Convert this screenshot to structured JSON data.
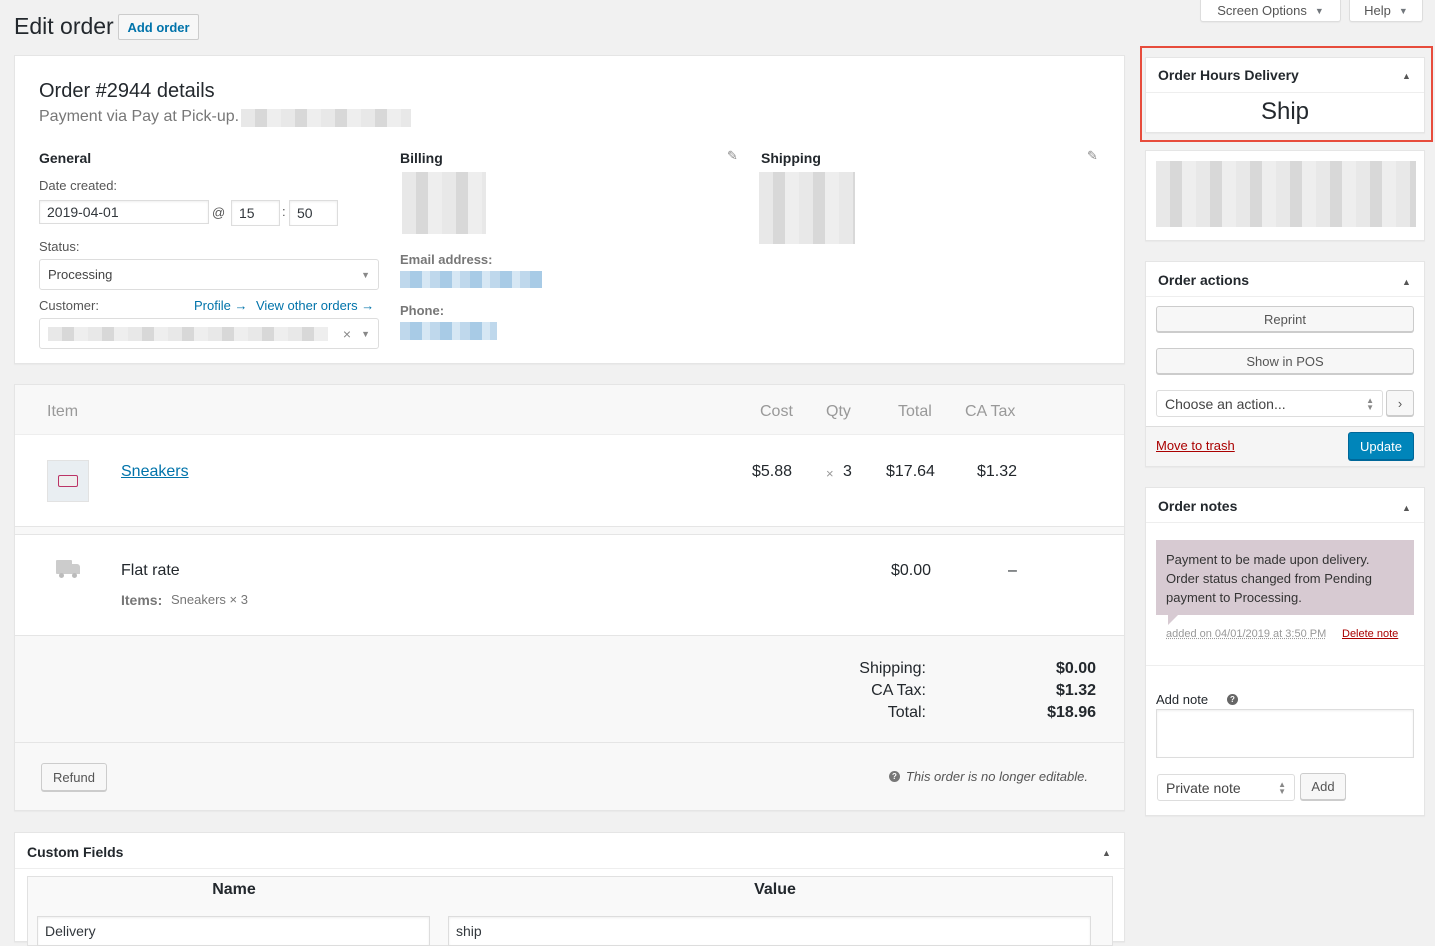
{
  "header": {
    "screen_options": "Screen Options",
    "help": "Help",
    "title": "Edit order",
    "add_order": "Add order"
  },
  "order": {
    "heading": "Order #2944 details",
    "payment": "Payment via Pay at Pick-up.",
    "general": {
      "title": "General",
      "date_label": "Date created:",
      "date": "2019-04-01",
      "at": "@",
      "hour": "15",
      "colon": ":",
      "minute": "50",
      "status_label": "Status:",
      "status": "Processing",
      "customer_label": "Customer:",
      "profile_link": "Profile →",
      "other_orders_link": "View other orders →",
      "clear_x": "×"
    },
    "billing": {
      "title": "Billing",
      "email_label": "Email address:",
      "phone_label": "Phone:"
    },
    "shipping": {
      "title": "Shipping"
    }
  },
  "items": {
    "columns": {
      "item": "Item",
      "cost": "Cost",
      "qty": "Qty",
      "total": "Total",
      "tax": "CA Tax"
    },
    "product": {
      "name": "Sneakers",
      "cost": "$5.88",
      "times": "×",
      "qty": "3",
      "total": "$17.64",
      "tax": "$1.32"
    },
    "shipping_line": {
      "name": "Flat rate",
      "items_label": "Items:",
      "items_value": "Sneakers × 3",
      "total": "$0.00",
      "tax": "–"
    },
    "totals": [
      {
        "label": "Shipping:",
        "value": "$0.00"
      },
      {
        "label": "CA Tax:",
        "value": "$1.32"
      },
      {
        "label": "Total:",
        "value": "$18.96"
      }
    ],
    "refund": "Refund",
    "not_editable": "This order is no longer editable."
  },
  "custom_fields": {
    "title": "Custom Fields",
    "col_name": "Name",
    "col_value": "Value",
    "row_name": "Delivery",
    "row_value": "ship"
  },
  "sidebar": {
    "hours_delivery": {
      "title": "Order Hours Delivery",
      "value": "Ship"
    },
    "actions": {
      "title": "Order actions",
      "reprint": "Reprint",
      "show_pos": "Show in POS",
      "choose": "Choose an action...",
      "trash": "Move to trash",
      "update": "Update"
    },
    "notes": {
      "title": "Order notes",
      "note_text": "Payment to be made upon delivery. Order status changed from Pending payment to Processing.",
      "meta": "added on 04/01/2019 at 3:50 PM",
      "delete": "Delete note",
      "add_note_label": "Add note",
      "note_type": "Private note",
      "add_button": "Add"
    }
  },
  "colors": {
    "accent": "#0073aa",
    "primary_button": "#0085ba",
    "highlight": "#e74c3c",
    "note_bg": "#d7cad2",
    "delete": "#a00"
  }
}
